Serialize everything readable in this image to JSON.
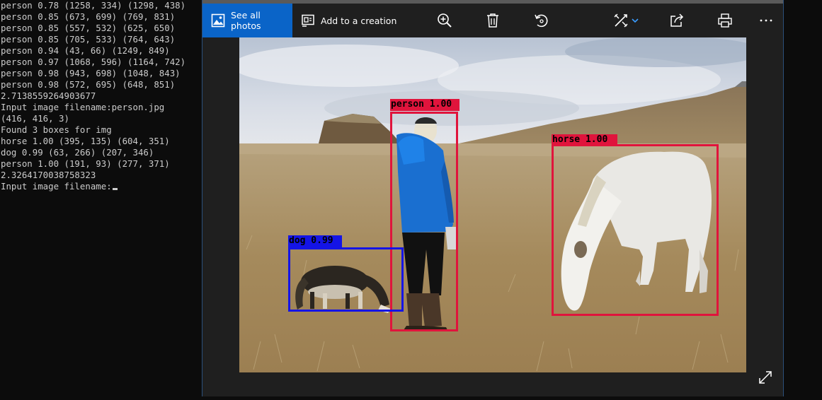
{
  "terminal": {
    "lines": [
      "person 0.78 (1258, 334) (1298, 438)",
      "person 0.85 (673, 699) (769, 831)",
      "person 0.85 (557, 532) (625, 650)",
      "person 0.85 (705, 533) (764, 643)",
      "person 0.94 (43, 66) (1249, 849)",
      "person 0.97 (1068, 596) (1164, 742)",
      "person 0.98 (943, 698) (1048, 843)",
      "person 0.98 (572, 695) (648, 851)",
      "2.7138559264903677",
      "Input image filename:person.jpg",
      "(416, 416, 3)",
      "Found 3 boxes for img",
      "horse 1.00 (395, 135) (604, 351)",
      "dog 0.99 (63, 266) (207, 346)",
      "person 1.00 (191, 93) (277, 371)",
      "2.3264170038758323"
    ],
    "prompt": "Input image filename:"
  },
  "toolbar": {
    "see_all_label": "See all photos",
    "add_creation_label": "Add to a creation",
    "icons": [
      "zoom-in-icon",
      "delete-icon",
      "rotate-icon",
      "edit-create-icon",
      "share-icon",
      "print-icon",
      "more-icon"
    ]
  },
  "detections": [
    {
      "label": "person 1.00",
      "color": "#e0143c"
    },
    {
      "label": "horse 1.00",
      "color": "#e0143c"
    },
    {
      "label": "dog 0.99",
      "color": "#1414e6"
    }
  ],
  "colors": {
    "accent": "#0a64c8",
    "terminal_bg": "#0c0c0c",
    "terminal_text": "#cccccc",
    "viewer_bg": "#1f1f1f"
  }
}
